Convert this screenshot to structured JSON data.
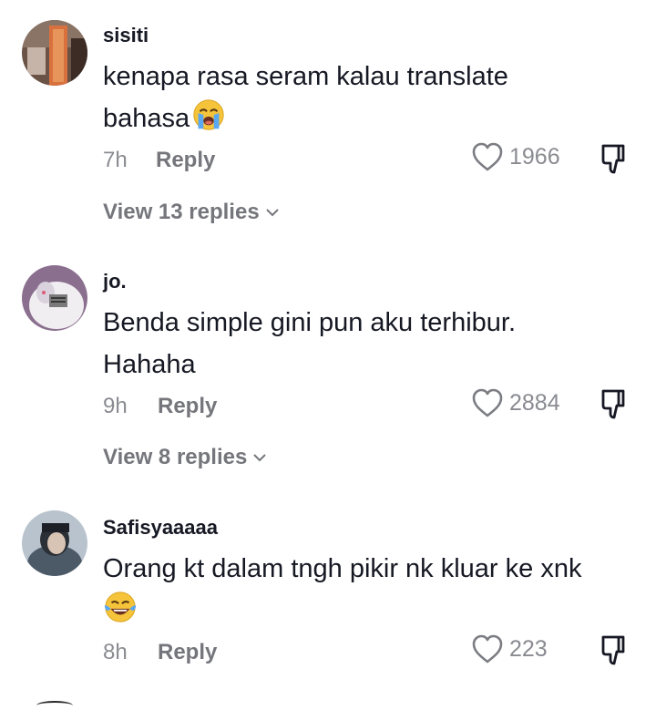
{
  "comments": [
    {
      "username": "sisiti",
      "text_line1": "kenapa rasa seram kalau translate",
      "text_line2": "bahasa",
      "emoji": "loudly-crying-face",
      "time": "7h",
      "reply_label": "Reply",
      "likes": "1966",
      "view_replies": "View 13 replies"
    },
    {
      "username": "jo.",
      "text_line1": "Benda simple gini pun aku terhibur.",
      "text_line2": "Hahaha",
      "time": "9h",
      "reply_label": "Reply",
      "likes": "2884",
      "view_replies": "View 8 replies"
    },
    {
      "username": "Safisyaaaaa",
      "text_line1": "Orang kt dalam tngh pikir nk kluar ke xnk",
      "emoji": "face-with-tears-of-joy",
      "time": "8h",
      "reply_label": "Reply",
      "likes": "223"
    }
  ],
  "icons": {
    "like": "heart-outline-icon",
    "dislike": "thumbs-down-icon",
    "expand": "chevron-down-icon"
  }
}
